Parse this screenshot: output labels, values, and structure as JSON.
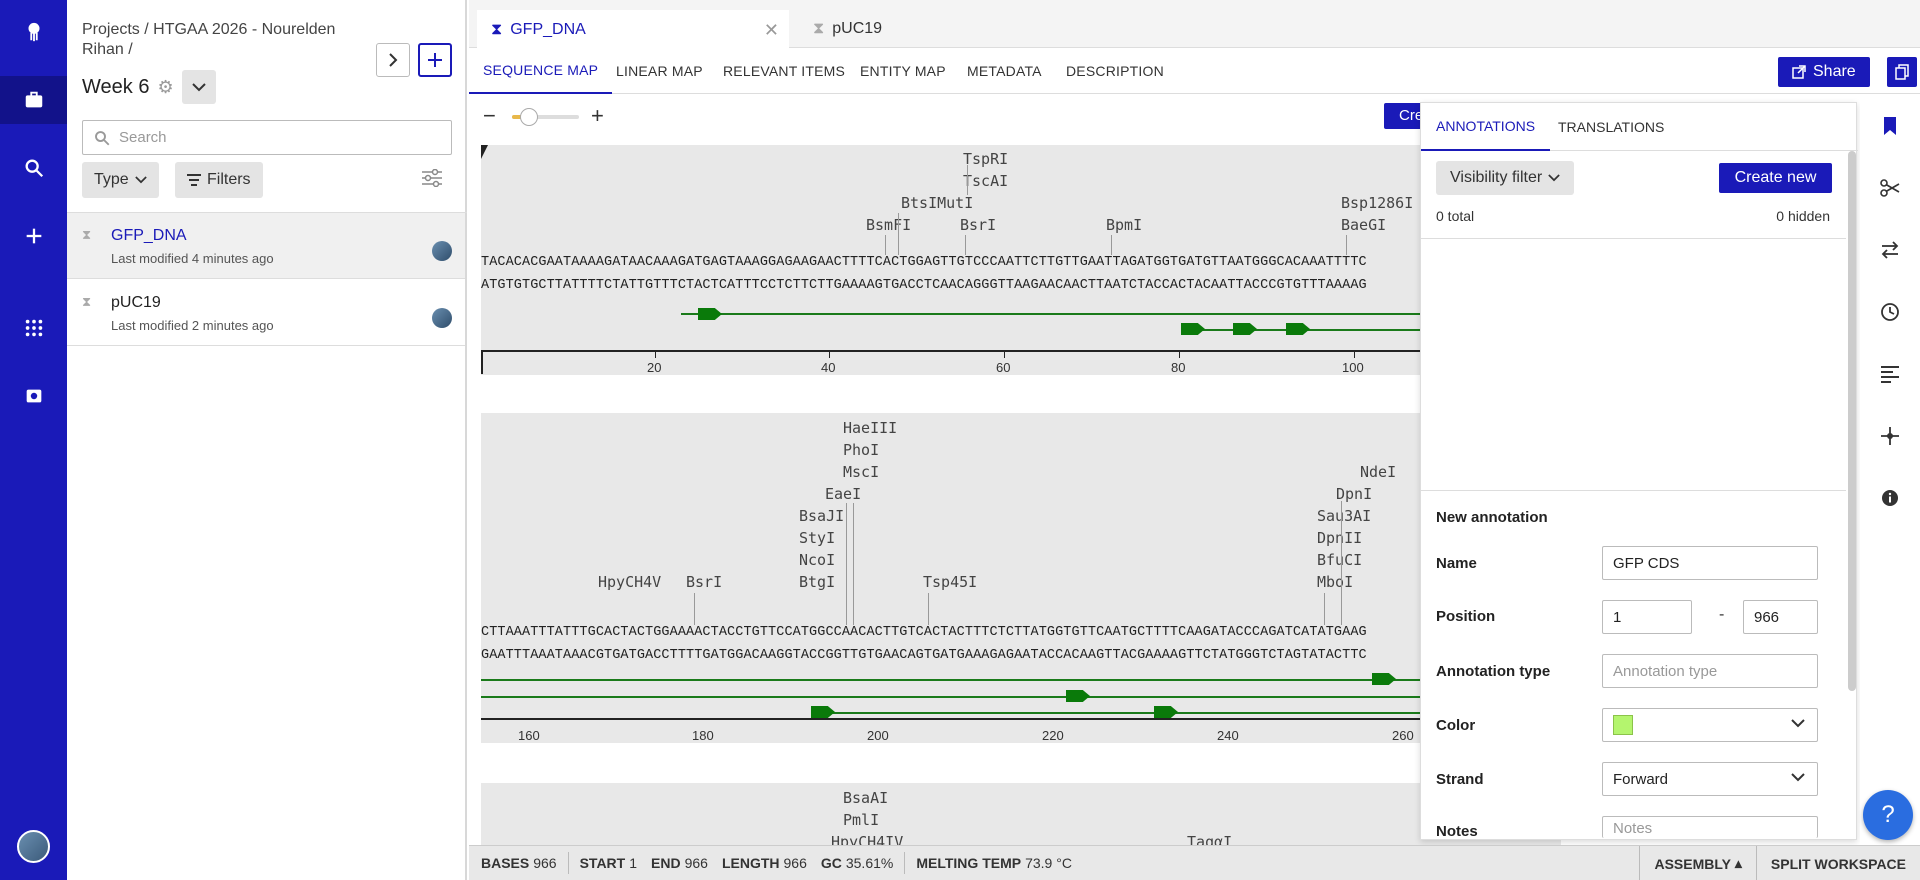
{
  "sidebar": {
    "breadcrumb": "Projects / HTGAA 2026 - Nourelden Rihan /",
    "folder_title": "Week 6",
    "search_placeholder": "Search",
    "type_label": "Type",
    "filters_label": "Filters",
    "items": [
      {
        "name": "GFP_DNA",
        "modified": "Last modified 4 minutes ago"
      },
      {
        "name": "pUC19",
        "modified": "Last modified 2 minutes ago"
      }
    ]
  },
  "doc_tabs": [
    {
      "label": "GFP_DNA"
    },
    {
      "label": "pUC19"
    }
  ],
  "view_tabs": [
    "SEQUENCE MAP",
    "LINEAR MAP",
    "RELEVANT ITEMS",
    "ENTITY MAP",
    "METADATA",
    "DESCRIPTION"
  ],
  "share_label": "Share",
  "create_peek": "Cre",
  "sequence": {
    "block1": {
      "enzymes": [
        "TspRI",
        "TscAI",
        "BtsIMutI",
        "BsmFI",
        "BsrI",
        "BpmI",
        "Bsp1286I",
        "BaeGI"
      ],
      "top": "TACACACGAATAAAAGATAACAAAGATGAGTAAAGGAGAAGAACTTTTCACTGGAGTTGTCCCAATTCTTGTTGAATTAGATGGTGATGTTAATGGGCACAAATTTTC",
      "bottom": "ATGTGTGCTTATTTTCTATTGTTTCTACTCATTTCCTCTTCTTGAAAAGTGACCTCAACAGGGTTAAGAACAACTTAATCTACCACTACAATTACCCGTGTTTAAAAG",
      "ticks": [
        "20",
        "40",
        "60",
        "80",
        "100"
      ]
    },
    "block2": {
      "enzymes": [
        "HaeIII",
        "PhoI",
        "MscI",
        "EaeI",
        "BsaJI",
        "StyI",
        "NcoI",
        "BtgI",
        "HpyCH4V",
        "BsrI",
        "Tsp45I",
        "NdeI",
        "DpnI",
        "Sau3AI",
        "DpnII",
        "BfuCI",
        "MboI"
      ],
      "top": "CTTAAATTTATTTGCACTACTGGAAAACTACCTGTTCCATGGCCAACACTTGTCACTACTTTCTCTTATGGTGTTCAATGCTTTTCAAGATACCCAGATCATATGAAG",
      "bottom": "GAATTTAAATAAACGTGATGACCTTTTGATGGACAAGGTACCGGTTGTGAACAGTGATGAAAGAGAATACCACAAGTTACGAAAAGTTCTATGGGTCTAGTATACTTC",
      "ticks": [
        "160",
        "180",
        "200",
        "220",
        "240",
        "260"
      ]
    },
    "block3": {
      "enzymes": [
        "BsaAI",
        "PmlI",
        "HpyCH4IV",
        "TaqαI"
      ]
    }
  },
  "panel": {
    "tabs": [
      "ANNOTATIONS",
      "TRANSLATIONS"
    ],
    "visibility_filter": "Visibility filter",
    "create_new": "Create new",
    "total": "0 total",
    "hidden": "0 hidden",
    "new_annotation": "New annotation",
    "fields": {
      "name_label": "Name",
      "name_value": "GFP CDS",
      "position_label": "Position",
      "position_start": "1",
      "position_dash": "-",
      "position_end": "966",
      "type_label": "Annotation type",
      "type_placeholder": "Annotation type",
      "color_label": "Color",
      "color_value": "#b4f56e",
      "strand_label": "Strand",
      "strand_value": "Forward",
      "notes_label": "Notes",
      "notes_placeholder": "Notes"
    }
  },
  "status": {
    "bases_label": "BASES",
    "bases": "966",
    "start_label": "START",
    "start": "1",
    "end_label": "END",
    "end": "966",
    "length_label": "LENGTH",
    "length": "966",
    "gc_label": "GC",
    "gc": "35.61%",
    "melt_label": "MELTING TEMP",
    "melt": "73.9 °C",
    "assembly": "ASSEMBLY",
    "split": "SPLIT WORKSPACE"
  },
  "colors": {
    "brand": "#1a1ab8",
    "feature": "#0a7a0a"
  }
}
